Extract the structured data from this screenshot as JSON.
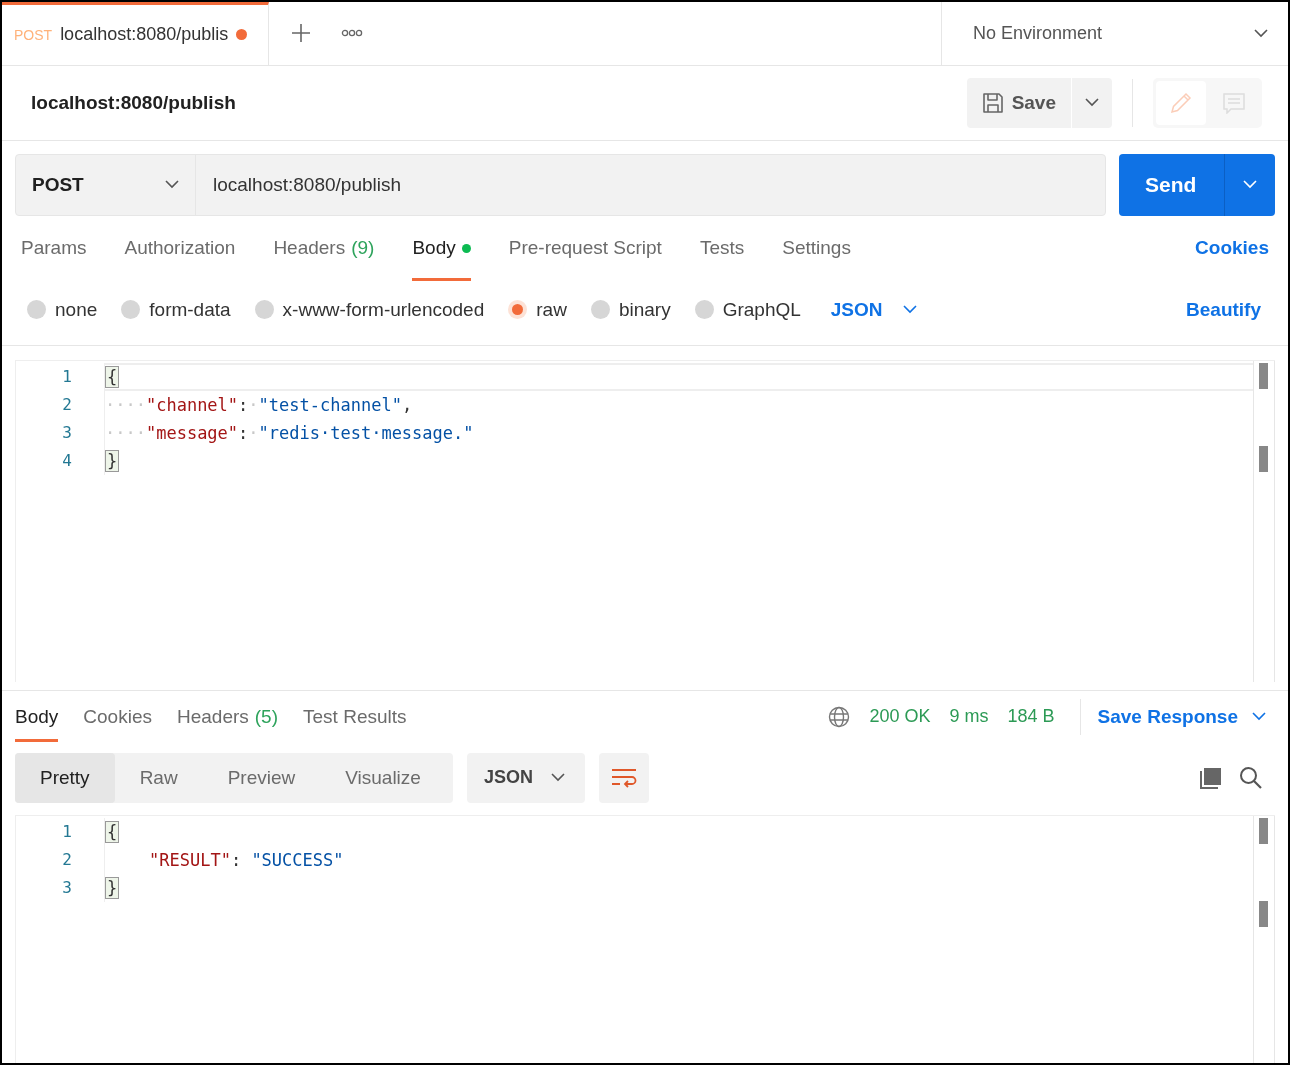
{
  "tabs": [
    {
      "method": "POST",
      "title": "localhost:8080/publis",
      "selected": true,
      "unsaved": true
    }
  ],
  "environment": {
    "value": "No Environment"
  },
  "request": {
    "title": "localhost:8080/publish",
    "save_label": "Save",
    "method": "POST",
    "url": "localhost:8080/publish",
    "send_label": "Send"
  },
  "request_tabs": [
    {
      "label": "Params",
      "selected": false,
      "modified": false
    },
    {
      "label": "Authorization",
      "selected": false,
      "modified": false
    },
    {
      "label": "Headers",
      "count": "(9)",
      "selected": false,
      "modified": false
    },
    {
      "label": "Body",
      "selected": true,
      "modified": true
    },
    {
      "label": "Pre-request Script",
      "selected": false,
      "modified": false
    },
    {
      "label": "Tests",
      "selected": false,
      "modified": false
    },
    {
      "label": "Settings",
      "selected": false,
      "modified": false
    }
  ],
  "cookies_link": "Cookies",
  "body_types": [
    {
      "label": "none",
      "selected": false
    },
    {
      "label": "form-data",
      "selected": false
    },
    {
      "label": "x-www-form-urlencoded",
      "selected": false
    },
    {
      "label": "raw",
      "selected": true
    },
    {
      "label": "binary",
      "selected": false
    },
    {
      "label": "GraphQL",
      "selected": false
    }
  ],
  "body_language": "JSON",
  "beautify_link": "Beautify",
  "request_body": {
    "lines": [
      {
        "number": "1",
        "current": true,
        "tokens": [
          {
            "kind": "bracket",
            "text": "{"
          }
        ]
      },
      {
        "number": "2",
        "current": false,
        "tokens": [
          {
            "kind": "ws",
            "text": "····"
          },
          {
            "kind": "key",
            "text": "\"channel\""
          },
          {
            "kind": "punct",
            "text": ":"
          },
          {
            "kind": "ws",
            "text": "·"
          },
          {
            "kind": "string",
            "text": "\"test-channel\""
          },
          {
            "kind": "punct",
            "text": ","
          }
        ]
      },
      {
        "number": "3",
        "current": false,
        "tokens": [
          {
            "kind": "ws",
            "text": "····"
          },
          {
            "kind": "key",
            "text": "\"message\""
          },
          {
            "kind": "punct",
            "text": ":"
          },
          {
            "kind": "ws",
            "text": "·"
          },
          {
            "kind": "string",
            "text": "\"redis·test·message.\""
          }
        ]
      },
      {
        "number": "4",
        "current": false,
        "tokens": [
          {
            "kind": "bracket",
            "text": "}"
          }
        ]
      }
    ]
  },
  "response_tabs": [
    {
      "label": "Body",
      "selected": true
    },
    {
      "label": "Cookies",
      "selected": false
    },
    {
      "label": "Headers",
      "count": "(5)",
      "selected": false
    },
    {
      "label": "Test Results",
      "selected": false
    }
  ],
  "response_status": {
    "status": "200 OK",
    "time": "9 ms",
    "size": "184 B"
  },
  "save_response": "Save Response",
  "view_modes": [
    {
      "label": "Pretty",
      "selected": true
    },
    {
      "label": "Raw",
      "selected": false
    },
    {
      "label": "Preview",
      "selected": false
    },
    {
      "label": "Visualize",
      "selected": false
    }
  ],
  "response_language": "JSON",
  "response_body": {
    "lines": [
      {
        "number": "1",
        "indented": false,
        "tokens": [
          {
            "kind": "bracket",
            "text": "{"
          }
        ]
      },
      {
        "number": "2",
        "indented": true,
        "tokens": [
          {
            "kind": "key",
            "text": "\"RESULT\""
          },
          {
            "kind": "punct",
            "text": ": "
          },
          {
            "kind": "string",
            "text": "\"SUCCESS\""
          }
        ]
      },
      {
        "number": "3",
        "indented": false,
        "tokens": [
          {
            "kind": "bracket",
            "text": "}"
          }
        ]
      }
    ]
  }
}
